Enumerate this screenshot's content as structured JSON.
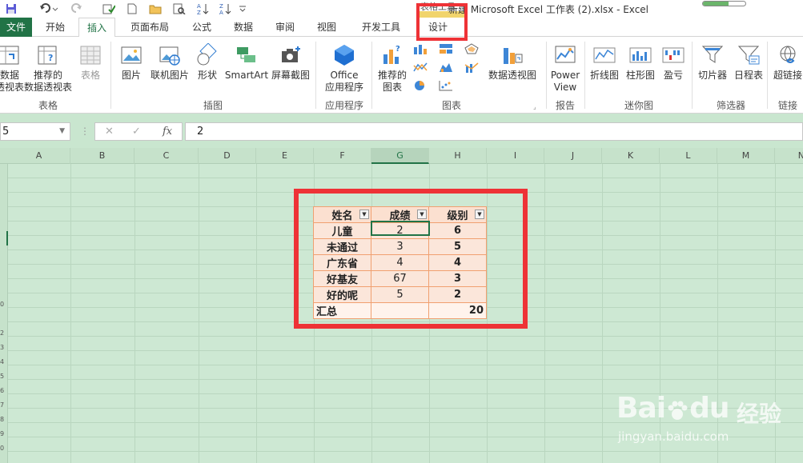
{
  "title_bar": {
    "title": "新建 Microsoft Excel 工作表 (2).xlsx - Excel",
    "context_tab_label": "表格工具"
  },
  "tabs": [
    {
      "label": "文件"
    },
    {
      "label": "开始"
    },
    {
      "label": "插入"
    },
    {
      "label": "页面布局"
    },
    {
      "label": "公式"
    },
    {
      "label": "数据"
    },
    {
      "label": "审阅"
    },
    {
      "label": "视图"
    },
    {
      "label": "开发工具"
    },
    {
      "label": "设计"
    }
  ],
  "ribbon": {
    "tables": {
      "pivot": "数据\n透视表",
      "recommended_pivot": "推荐的\n数据透视表",
      "table": "表格",
      "group": "表格"
    },
    "illustrations": {
      "pictures": "图片",
      "online_pictures": "联机图片",
      "shapes": "形状",
      "smartart": "SmartArt",
      "screenshot": "屏幕截图",
      "group": "插图"
    },
    "apps": {
      "office_apps": "Office\n应用程序",
      "group": "应用程序"
    },
    "charts": {
      "recommended": "推荐的\n图表",
      "pivot_chart": "数据透视图",
      "group": "图表"
    },
    "reports": {
      "power_view": "Power\nView",
      "group": "报告"
    },
    "sparklines": {
      "line": "折线图",
      "column": "柱形图",
      "win_loss": "盈亏",
      "group": "迷你图"
    },
    "filters": {
      "slicer": "切片器",
      "timeline": "日程表",
      "group": "筛选器"
    },
    "links": {
      "hyperlink": "超链接",
      "group": "链接"
    }
  },
  "formula_bar": {
    "name_box": "5",
    "fx": "fx",
    "value": "2"
  },
  "columns": [
    "A",
    "B",
    "C",
    "D",
    "E",
    "F",
    "G",
    "H",
    "I",
    "J",
    "K",
    "L",
    "M",
    "N"
  ],
  "rows": [
    "",
    "",
    "",
    "",
    "",
    "",
    "",
    "",
    "",
    "0",
    "",
    "2",
    "3",
    "4",
    "5",
    "6",
    "7",
    "8",
    "9",
    "0"
  ],
  "table": {
    "headers": [
      "姓名",
      "成绩",
      "级别"
    ],
    "rows": [
      {
        "name": "儿童",
        "score": "2",
        "level": "6"
      },
      {
        "name": "未通过",
        "score": "3",
        "level": "5"
      },
      {
        "name": "广东省",
        "score": "4",
        "level": "4"
      },
      {
        "name": "好基友",
        "score": "67",
        "level": "3"
      },
      {
        "name": "好的呢",
        "score": "5",
        "level": "2"
      }
    ],
    "total_label": "汇总",
    "total_value": "20"
  },
  "watermark": {
    "brand": "Bai",
    "brand2": "du",
    "brand_cn": "经验",
    "url": "jingyan.baidu.com"
  }
}
